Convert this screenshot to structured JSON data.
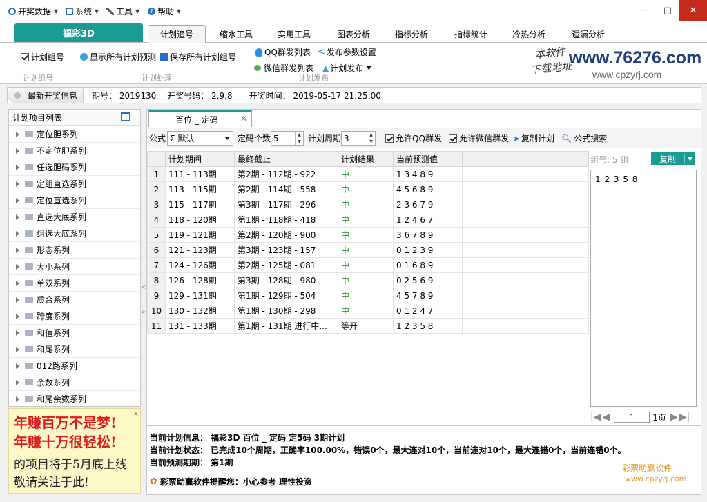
{
  "menubar": {
    "items": [
      {
        "label": "开奖数据",
        "icon": "circle-icon"
      },
      {
        "label": "系统",
        "icon": "monitor-icon"
      },
      {
        "label": "工具",
        "icon": "tools-icon"
      },
      {
        "label": "帮助",
        "icon": "help-icon"
      }
    ],
    "window_buttons": {
      "minimize": "─",
      "maximize": "□",
      "close": "✕"
    }
  },
  "tabs": {
    "brand": "福彩3D",
    "items": [
      "计划追号",
      "缩水工具",
      "实用工具",
      "图表分析",
      "指标分析",
      "指标统计",
      "冷热分析",
      "遗漏分析"
    ],
    "active": "计划追号"
  },
  "ribbon": {
    "plan_group_label": "计划组号",
    "plan_group_name": "计划组号",
    "show_all": "显示所有计划预测",
    "save_all": "保存所有计划组号",
    "process_group_name": "计划处理",
    "qq_list": "QQ群发列表",
    "publish_settings": "发布参数设置",
    "wechat_list": "微信群发列表",
    "plan_publish": "计划发布",
    "publish_group_name": "计划发布"
  },
  "logo": {
    "line1": "本软件",
    "line2": "下载地址",
    "url_main": "www.76276.com",
    "url_sub": "www.cpzyrj.com"
  },
  "infobar": {
    "label": "最新开奖信息",
    "issue": "期号：  2019130",
    "numbers": "开奖号码：  2,9,8",
    "time": "开奖时间：  2019-05-17 21:25:00"
  },
  "left_panel": {
    "title": "计划项目列表",
    "items": [
      "定位胆系列",
      "不定位胆系列",
      "任选胆码系列",
      "定组直选系列",
      "定位直选系列",
      "直选大底系列",
      "组选大底系列",
      "形态系列",
      "大小系列",
      "单双系列",
      "质合系列",
      "跨度系列",
      "和值系列",
      "和尾系列",
      "012路系列",
      "余数系列",
      "和尾余数系列"
    ]
  },
  "ad": {
    "line1": "年赚百万不是梦!",
    "line2": "年赚十万很轻松!",
    "line3": "的项目将于5月底上线",
    "line4": "敬请关注于此!",
    "close": "x"
  },
  "content": {
    "tab_title": "百位 _ 定码",
    "tab_close": "✕",
    "toolbar": {
      "formula_label": "公式",
      "formula_value": "Σ 默认",
      "count_label": "定码个数",
      "count_value": "5",
      "period_label": "计划周期",
      "period_value": "3",
      "allow_qq": "允许QQ群发",
      "allow_wechat": "允许微信群发",
      "copy_plan": "复制计划",
      "formula_search": "公式搜索"
    },
    "table": {
      "headers": [
        "",
        "计划期间",
        "最终截止",
        "计划结果",
        "当前预测值",
        ""
      ],
      "rows": [
        {
          "no": "1",
          "period": "111 - 113期",
          "deadline": "第2期 - 112期 - 922",
          "result": "中",
          "pred": "1 3 4 8 9"
        },
        {
          "no": "2",
          "period": "113 - 115期",
          "deadline": "第2期 - 114期 - 558",
          "result": "中",
          "pred": "4 5 6 8 9"
        },
        {
          "no": "3",
          "period": "115 - 117期",
          "deadline": "第3期 - 117期 - 296",
          "result": "中",
          "pred": "2 3 6 7 9"
        },
        {
          "no": "4",
          "period": "118 - 120期",
          "deadline": "第1期 - 118期 - 418",
          "result": "中",
          "pred": "1 2 4 6 7"
        },
        {
          "no": "5",
          "period": "119 - 121期",
          "deadline": "第2期 - 120期 - 900",
          "result": "中",
          "pred": "3 6 7 8 9"
        },
        {
          "no": "6",
          "period": "121 - 123期",
          "deadline": "第3期 - 123期 - 157",
          "result": "中",
          "pred": "0 1 2 3 9"
        },
        {
          "no": "7",
          "period": "124 - 126期",
          "deadline": "第2期 - 125期 - 081",
          "result": "中",
          "pred": "0 1 6 8 9"
        },
        {
          "no": "8",
          "period": "126 - 128期",
          "deadline": "第3期 - 128期 - 980",
          "result": "中",
          "pred": "0 2 5 6 9"
        },
        {
          "no": "9",
          "period": "129 - 131期",
          "deadline": "第1期 - 129期 - 504",
          "result": "中",
          "pred": "4 5 7 8 9"
        },
        {
          "no": "10",
          "period": "130 - 132期",
          "deadline": "第1期 - 130期 - 298",
          "result": "中",
          "pred": "0 1 2 4 7"
        },
        {
          "no": "11",
          "period": "131 - 133期",
          "deadline": "第1期 - 131期 进行中...",
          "result": "等开",
          "pred": "1 2 3 5 8"
        }
      ]
    },
    "right_panel": {
      "group_label": "组号: 5 组",
      "copy_button": "复制",
      "numbers": "1 2 3 5 8",
      "page_input": "1",
      "page_total": "1页"
    },
    "summary": {
      "line1": "当前计划信息：  福彩3D    百位 _ 定码    定5码    3期计划",
      "line2": "当前计划状态：  已完成10个周期，正确率100.00%，错误0个，最大连对10个，当前连对10个，最大连错0个，当前连错0个。",
      "line3": "当前预测期期：  第1期",
      "line4": "彩票助赢软件提醒您：小心参考    理性投资"
    },
    "watermark": {
      "name": "彩票助赢软件",
      "url": "www.cpzyrj.com"
    }
  },
  "colors": {
    "accent": "#1a9c94",
    "hit": "#2a9a2a",
    "ad_red": "#e11b1b",
    "watermark": "#e29a28"
  }
}
